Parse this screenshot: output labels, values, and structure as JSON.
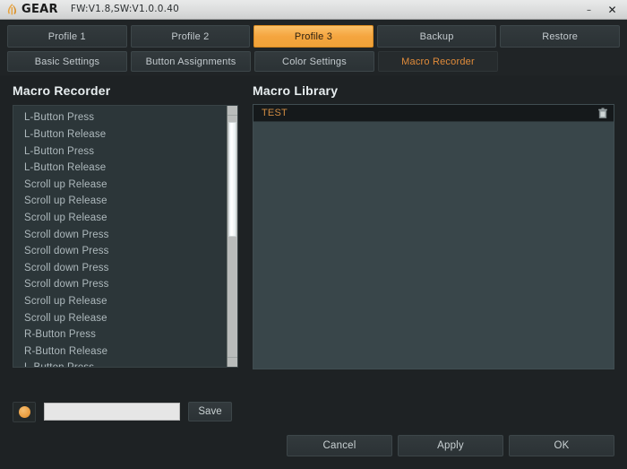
{
  "window": {
    "brand_name": "GEAR",
    "brand_icon": "leaf-logo-icon",
    "version_text": "FW:V1.8,SW:V1.0.0.40",
    "minimize_label": "–",
    "close_label": "✕"
  },
  "colors": {
    "accent_orange": "#efa238",
    "accent_text_orange": "#d08b42",
    "window_bg": "#1e2224",
    "panel_bg": "#2c3639",
    "library_bg": "#39464a",
    "tab_bg": "#2f3639",
    "text_primary": "#c9d1d3",
    "text_muted": "#aeb9bd"
  },
  "tabs": {
    "primary": [
      {
        "label": "Profile 1",
        "active": false
      },
      {
        "label": "Profile 2",
        "active": false
      },
      {
        "label": "Profile 3",
        "active": true
      },
      {
        "label": "Backup",
        "active": false
      },
      {
        "label": "Restore",
        "active": false
      }
    ],
    "secondary": [
      {
        "label": "Basic Settings",
        "selected": false
      },
      {
        "label": "Button Assignments",
        "selected": false
      },
      {
        "label": "Color Settings",
        "selected": false
      },
      {
        "label": "Macro Recorder",
        "selected": true
      }
    ]
  },
  "recorder": {
    "title": "Macro Recorder",
    "events": [
      "L-Button Press",
      "L-Button Release",
      "L-Button Press",
      "L-Button Release",
      "Scroll up Release",
      "Scroll up Release",
      "Scroll up Release",
      "Scroll down Press",
      "Scroll down Press",
      "Scroll down Press",
      "Scroll down Press",
      "Scroll up Release",
      "Scroll up Release",
      "R-Button Press",
      "R-Button Release",
      "L-Button Press"
    ],
    "scroll": {
      "thumb_top_pct": 6,
      "thumb_height_pct": 44
    }
  },
  "library": {
    "title": "Macro Library",
    "items": [
      {
        "name": "TEST",
        "delete_icon": "trash-icon"
      }
    ]
  },
  "controls": {
    "record_button_icon": "record-dot-icon",
    "macro_name_value": "",
    "macro_name_placeholder": "",
    "save_label": "Save"
  },
  "footer": {
    "cancel_label": "Cancel",
    "apply_label": "Apply",
    "ok_label": "OK"
  }
}
